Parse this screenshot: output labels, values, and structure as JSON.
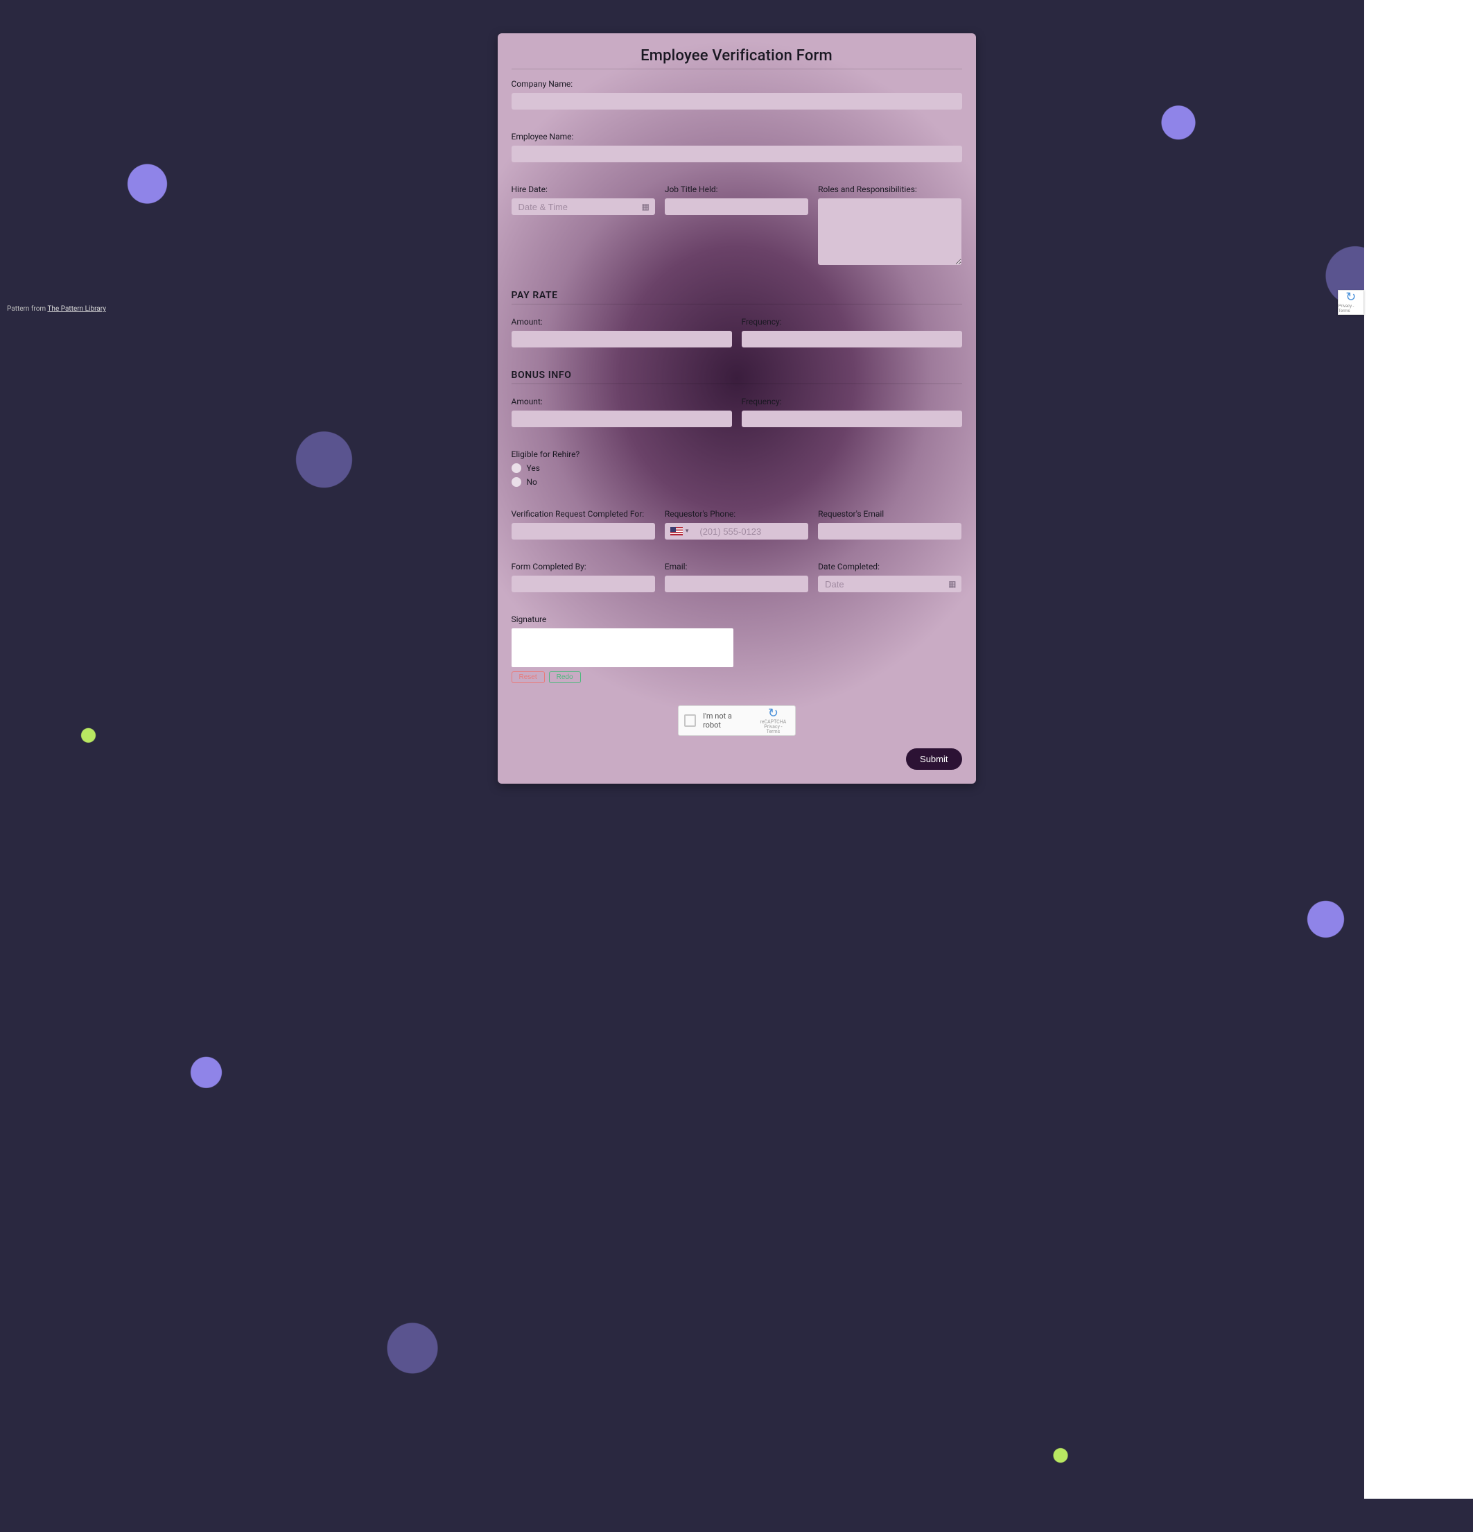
{
  "credit": {
    "prefix": "Pattern from ",
    "link_text": "The Pattern Library"
  },
  "title": "Employee Verification Form",
  "fields": {
    "company_label": "Company Name:",
    "employee_label": "Employee Name:",
    "hire_date_label": "Hire Date:",
    "hire_date_placeholder": "Date & Time",
    "job_title_label": "Job Title Held:",
    "roles_label": "Roles and Responsibilities:"
  },
  "pay_rate": {
    "heading": "PAY RATE",
    "amount_label": "Amount:",
    "frequency_label": "Frequency:"
  },
  "bonus": {
    "heading": "BONUS INFO",
    "amount_label": "Amount:",
    "frequency_label": "Frequency:"
  },
  "rehire": {
    "label": "Eligible for Rehire?",
    "yes": "Yes",
    "no": "No"
  },
  "requestor": {
    "completed_for_label": "Verification Request Completed For:",
    "phone_label": "Requestor's Phone:",
    "phone_placeholder": "(201) 555-0123",
    "email_label": "Requestor's Email"
  },
  "completion": {
    "by_label": "Form Completed By:",
    "email_label": "Email:",
    "date_label": "Date Completed:",
    "date_placeholder": "Date"
  },
  "signature": {
    "label": "Signature",
    "reset": "Reset",
    "redo": "Redo"
  },
  "captcha": {
    "text": "I'm not a robot",
    "brand": "reCAPTCHA",
    "legal": "Privacy - Terms"
  },
  "submit": "Submit",
  "badge": {
    "brand": "reCAPTCHA",
    "legal": "Privacy - Terms"
  }
}
